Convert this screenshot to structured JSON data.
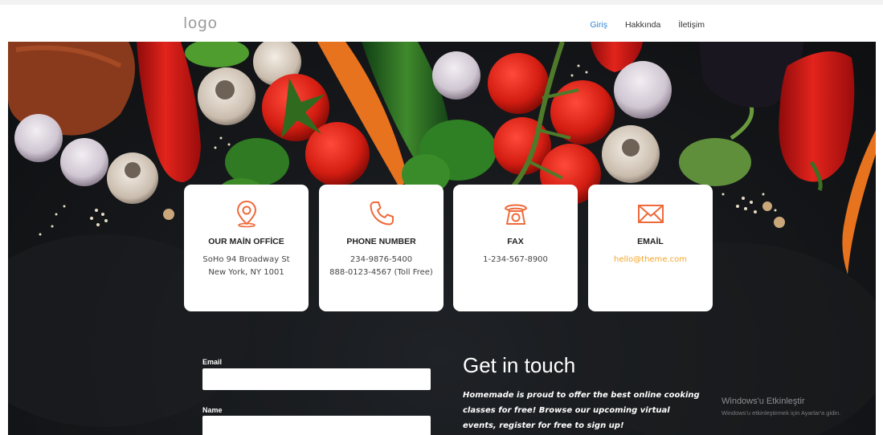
{
  "header": {
    "logo": "logo",
    "nav": [
      {
        "label": "Giriş",
        "active": true
      },
      {
        "label": "Hakkında",
        "active": false
      },
      {
        "label": "İletişim",
        "active": false
      }
    ]
  },
  "cards": [
    {
      "icon": "map-pin-icon",
      "title": "OUR MAİN OFFİCE",
      "lines": [
        "SoHo 94 Broadway St",
        "New York, NY 1001"
      ]
    },
    {
      "icon": "phone-icon",
      "title": "PHONE NUMBER",
      "lines": [
        "234-9876-5400",
        "888-0123-4567 (Toll Free)"
      ]
    },
    {
      "icon": "fax-icon",
      "title": "FAX",
      "lines": [
        "1-234-567-8900"
      ]
    },
    {
      "icon": "envelope-icon",
      "title": "EMAİL",
      "lines": [
        "hello@theme.com"
      ]
    }
  ],
  "form": {
    "email_label": "Email",
    "name_label": "Name"
  },
  "contact": {
    "title": "Get in touch",
    "text": "Homemade is proud to offer the best online cooking classes for free! Browse our upcoming virtual events, register for free to sign up!"
  },
  "watermark": {
    "title": "Windows'u Etkinleştir",
    "subtitle": "Windows'u etkinleştirmek için Ayarlar'a gidin."
  },
  "colors": {
    "accent": "#ef6a3a",
    "link": "#f4a52a",
    "nav_active": "#2f86d6"
  }
}
